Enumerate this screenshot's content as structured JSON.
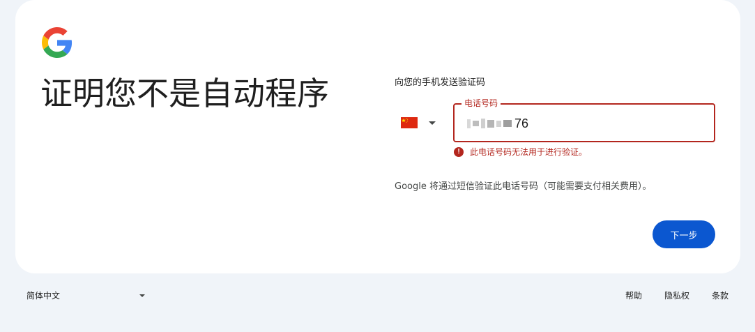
{
  "header": {
    "logo_icon": "google-g-logo",
    "title": "证明您不是自动程序"
  },
  "form": {
    "send_label": "向您的手机发送验证码",
    "country": {
      "flag_icon": "china-flag-icon",
      "selected": "CN"
    },
    "phone": {
      "label": "电话号码",
      "visible_digits": "76",
      "masked": true
    },
    "error": {
      "icon": "error-icon",
      "message": "此电话号码无法用于进行验证。"
    },
    "notice": "Google 将通过短信验证此电话号码（可能需要支付相关费用）。",
    "next_label": "下一步"
  },
  "footer": {
    "language": "简体中文",
    "links": [
      "帮助",
      "隐私权",
      "条款"
    ]
  },
  "colors": {
    "accent": "#0b57d0",
    "error": "#b3261e",
    "page_background": "#f0f4f9",
    "card_background": "#ffffff"
  }
}
